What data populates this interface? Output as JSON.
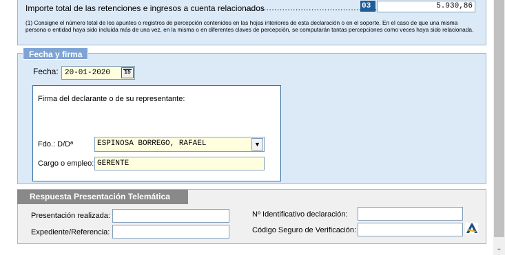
{
  "totals": {
    "importe_label": "Importe total de las retenciones e ingresos a cuenta relacionados",
    "dots": "........................................................",
    "key": "03",
    "amount": "5.930,86",
    "note": "(1) Consigne el número total de los apuntes o registros de percepción contenidos en las hojas interiores de esta declaración o en el soporte. En el caso de que una misma persona o entidad haya sido incluida más de una vez, en la misma o en diferentes claves de percepción, se computarán tantas percepciones como veces haya sido relacionada."
  },
  "fecha_firma": {
    "legend": "Fecha y firma",
    "fecha_label": "Fecha:",
    "fecha_value": "20-01-2020",
    "calendar_glyph": "15",
    "firma_title": "Firma del declarante o de su representante:",
    "fdo_label": "Fdo.: D/Dª",
    "fdo_value": "ESPINOSA BORREGO, RAFAEL",
    "dropdown_glyph": "▼",
    "cargo_label": "Cargo o empleo:",
    "cargo_value": "GERENTE"
  },
  "respuesta": {
    "header": "Respuesta Presentación Telemática",
    "presentacion_label": "Presentación realizada:",
    "expediente_label": "Expediente/Referencia:",
    "identificativo_label": "Nº Identificativo declaración:",
    "csv_label": "Código Seguro de Verificación:",
    "presentacion_value": "",
    "expediente_value": "",
    "identificativo_value": "",
    "csv_value": "",
    "logo_icon": "agencia-tributaria-logo-icon"
  },
  "scrollbar": {
    "down_glyph": "⌄"
  },
  "colors": {
    "panel_bg": "#dce9f7",
    "legend_bg": "#7ea4d4",
    "key_bg": "#205c96",
    "field_yellow": "#ffffe0",
    "resp_header_bg": "#898989"
  }
}
